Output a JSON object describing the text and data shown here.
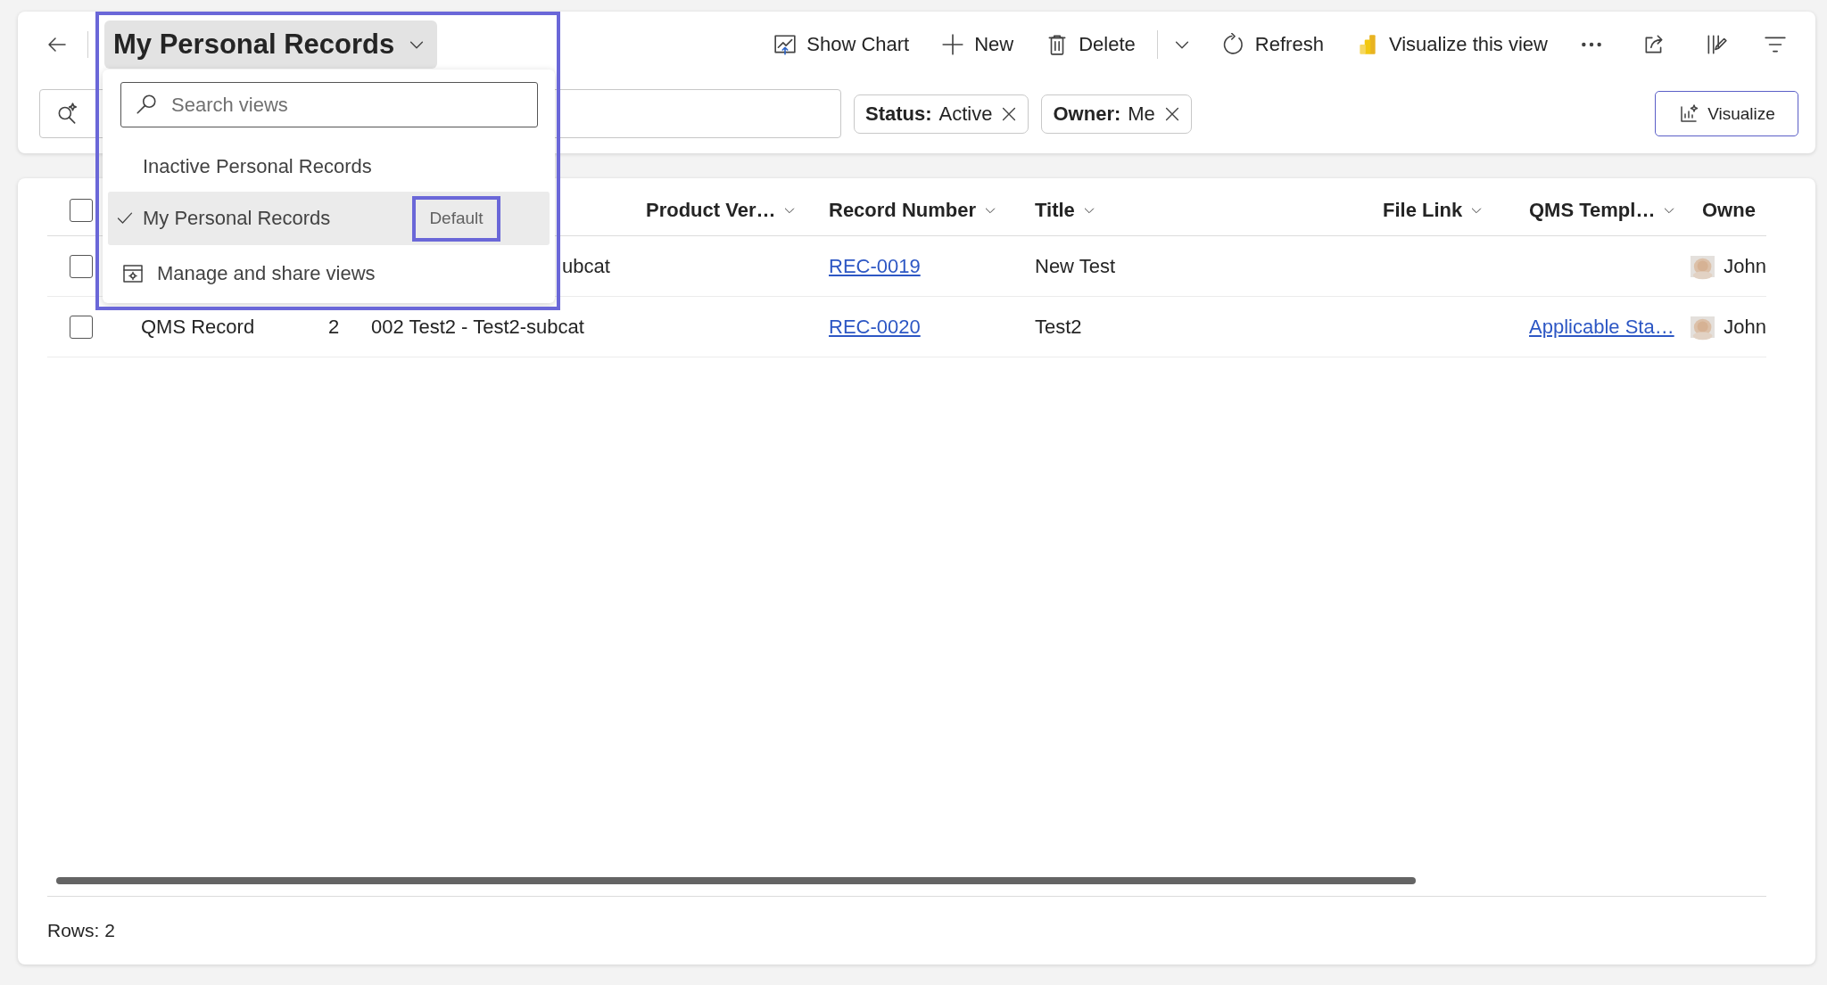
{
  "view_selector": {
    "title": "My Personal Records",
    "expanded": true
  },
  "toolbar": [
    {
      "kind": "chart",
      "label": "Show Chart"
    },
    {
      "kind": "new",
      "label": "New"
    },
    {
      "kind": "delete",
      "label": "Delete"
    },
    {
      "kind": "refresh",
      "label": "Refresh"
    },
    {
      "kind": "powerbi",
      "label": "Visualize this view"
    }
  ],
  "filters": [
    {
      "name": "Status:",
      "value": "Active"
    },
    {
      "name": "Owner:",
      "value": "Me"
    }
  ],
  "visualize_button": {
    "label": "Visualize"
  },
  "view_menu": {
    "highlighted": true,
    "search_placeholder": "Search views",
    "manage_label": "Manage and share views",
    "views": [
      {
        "label": "Inactive Personal Records",
        "selected": false
      },
      {
        "label": "My Personal Records",
        "selected": true,
        "badge": "Default",
        "badge_highlighted": true
      }
    ]
  },
  "table": {
    "all_selected": false,
    "columns": [
      {},
      {},
      {},
      {
        "label": "Product Ver…"
      },
      {
        "label": "Record Number"
      },
      {
        "label": "Title"
      },
      {
        "label": "File Link"
      },
      {
        "label": "QMS Templ…"
      },
      {
        "label": "Owne"
      }
    ],
    "rows": [
      {
        "selected": false,
        "cells": [
          {
            "kind": "empty"
          },
          {
            "kind": "empty"
          },
          {
            "kind": "partial",
            "text": "ubcat"
          },
          {
            "kind": "empty"
          },
          {
            "kind": "link",
            "text": "REC-0019"
          },
          {
            "kind": "text",
            "text": "New Test"
          },
          {
            "kind": "empty"
          },
          {
            "kind": "empty"
          },
          {
            "kind": "owner",
            "text": "John"
          }
        ]
      },
      {
        "selected": false,
        "cells": [
          {
            "kind": "text",
            "text": "QMS Record"
          },
          {
            "kind": "text",
            "text": "2"
          },
          {
            "kind": "text",
            "text": "002 Test2 - Test2-subcat"
          },
          {
            "kind": "empty"
          },
          {
            "kind": "link",
            "text": "REC-0020"
          },
          {
            "kind": "text",
            "text": "Test2"
          },
          {
            "kind": "empty"
          },
          {
            "kind": "link",
            "text": "Applicable Sta…"
          },
          {
            "kind": "owner",
            "text": "John"
          }
        ]
      }
    ]
  },
  "footer": {
    "rows_label": "Rows: 2"
  }
}
